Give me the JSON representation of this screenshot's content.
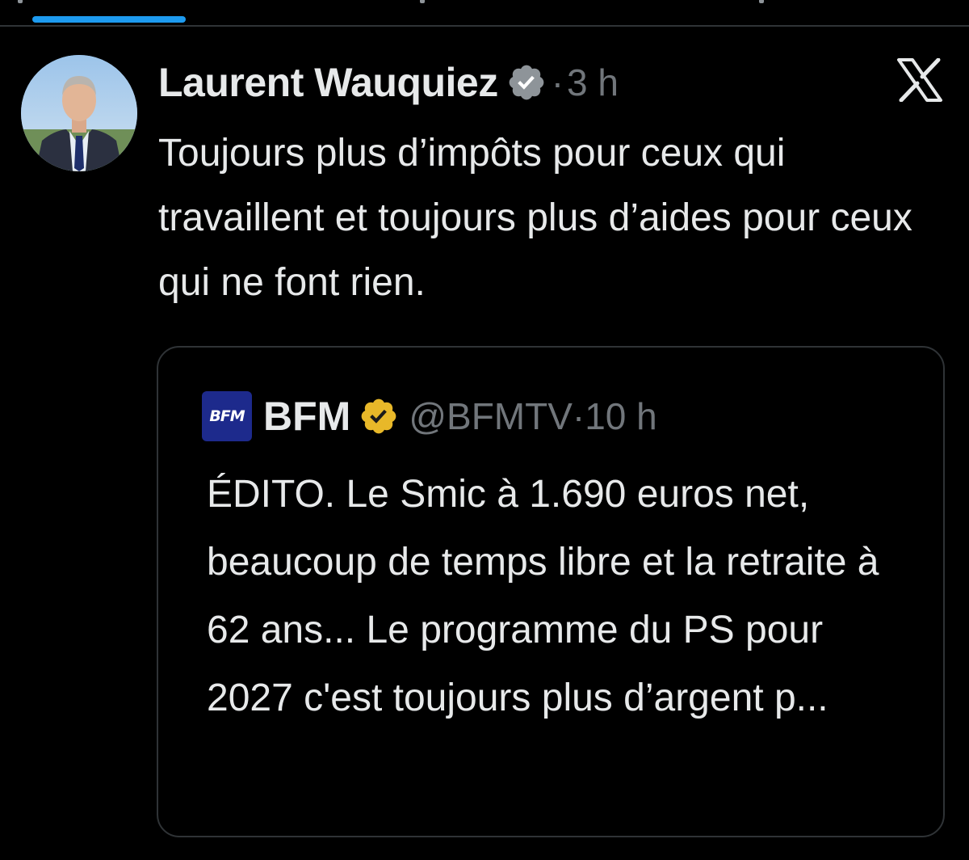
{
  "tweet": {
    "author_name": "Laurent Wauquiez",
    "separator": "·",
    "time": "3 h",
    "text": "Toujours plus d’impôts pour ceux qui travaillent et toujours plus d’aides pour ceux qui ne font rien.",
    "verified_badge_color": "#8e9499",
    "avatar_icon": "person-photo",
    "platform_icon": "x-logo-icon"
  },
  "quoted_tweet": {
    "logo_text": "BFM",
    "author_name": "BFM",
    "handle_time": "@BFMTV·10 h",
    "text": "ÉDITO. Le Smic à 1.690 euros net, beaucoup de temps libre et la retraite à 62 ans... Le programme du PS pour 2027 c'est toujours plus d’argent p...",
    "verified_badge_color": "#e8b829",
    "logo_color": "#1d2a8c"
  },
  "colors": {
    "background": "#000000",
    "text": "#e7e9ea",
    "secondary_text": "#71767b",
    "border": "#2f3336",
    "accent": "#1d9bf0"
  }
}
